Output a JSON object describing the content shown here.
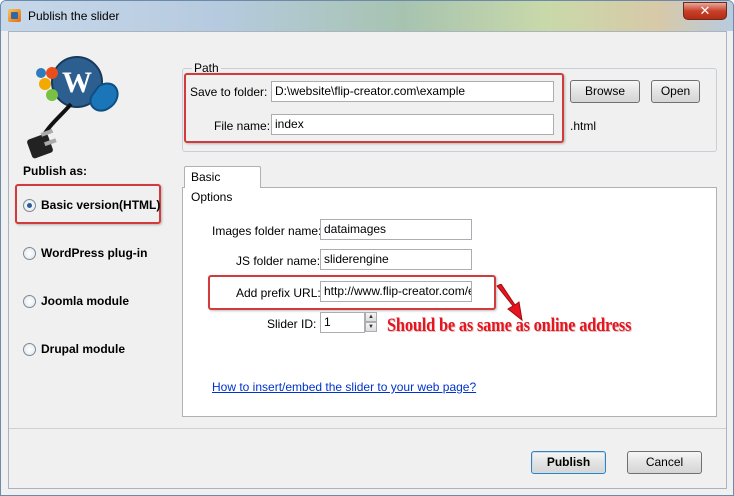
{
  "window": {
    "title": "Publish the slider",
    "close_glyph": "✕"
  },
  "sidebar": {
    "publish_as_label": "Publish as:",
    "options": [
      {
        "label": "Basic version(HTML)",
        "selected": true
      },
      {
        "label": "WordPress plug-in",
        "selected": false
      },
      {
        "label": "Joomla module",
        "selected": false
      },
      {
        "label": "Drupal module",
        "selected": false
      }
    ]
  },
  "path": {
    "group_label": "Path",
    "save_to_folder_label": "Save to folder:",
    "save_to_folder_value": "D:\\website\\flip-creator.com\\example",
    "browse_label": "Browse",
    "open_label": "Open",
    "file_name_label": "File name:",
    "file_name_value": "index",
    "extension": ".html"
  },
  "basic_options": {
    "tab_label": "Basic Options",
    "images_folder_label": "Images folder name:",
    "images_folder_value": "dataimages",
    "js_folder_label": "JS folder name:",
    "js_folder_value": "sliderengine",
    "prefix_url_label": "Add prefix URL:",
    "prefix_url_value": "http://www.flip-creator.com/e",
    "slider_id_label": "Slider ID:",
    "slider_id_value": "1",
    "spin_up": "▲",
    "spin_down": "▼",
    "help_link": "How to insert/embed the slider to your web page?"
  },
  "annotation": {
    "text": "Should be as same as online address",
    "color": "#e8141e"
  },
  "footer": {
    "publish_label": "Publish",
    "cancel_label": "Cancel"
  },
  "icons": {
    "app": "app-icon",
    "logo": "cms-plug-logo"
  }
}
